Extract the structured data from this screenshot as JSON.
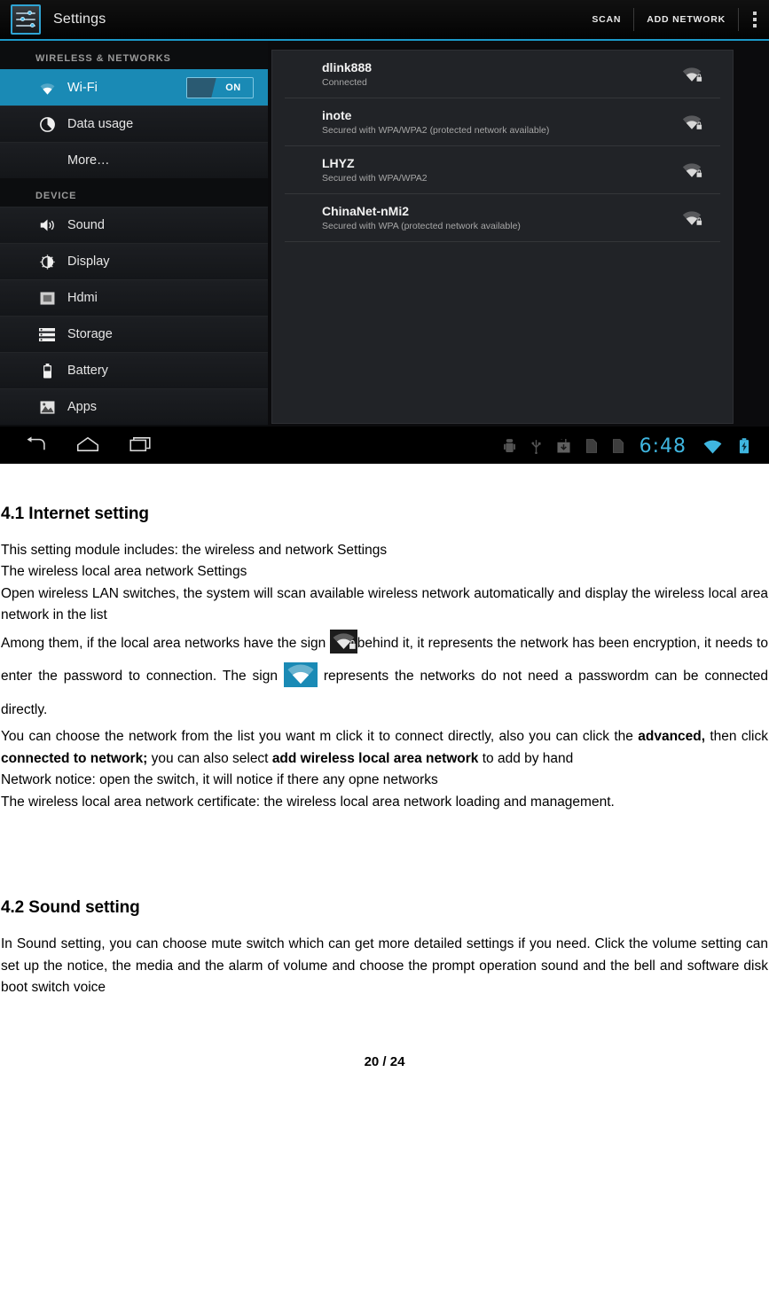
{
  "screenshot": {
    "actionbar": {
      "app_icon": "settings-sliders-icon",
      "title": "Settings",
      "scan_label": "SCAN",
      "add_network_label": "ADD NETWORK",
      "overflow_label": "overflow-menu"
    },
    "sidebar": {
      "sections": [
        {
          "header": "WIRELESS & NETWORKS",
          "items": [
            {
              "label": "Wi-Fi",
              "icon": "wifi-icon",
              "selected": true,
              "toggle": "ON"
            },
            {
              "label": "Data usage",
              "icon": "data-usage-icon",
              "selected": false
            },
            {
              "label": "More…",
              "icon": "",
              "selected": false
            }
          ]
        },
        {
          "header": "DEVICE",
          "items": [
            {
              "label": "Sound",
              "icon": "speaker-icon",
              "selected": false
            },
            {
              "label": "Display",
              "icon": "brightness-icon",
              "selected": false
            },
            {
              "label": "Hdmi",
              "icon": "hdmi-icon",
              "selected": false
            },
            {
              "label": "Storage",
              "icon": "storage-icon",
              "selected": false
            },
            {
              "label": "Battery",
              "icon": "battery-icon",
              "selected": false
            },
            {
              "label": "Apps",
              "icon": "apps-image-icon",
              "selected": false
            }
          ]
        }
      ]
    },
    "networks": [
      {
        "name": "dlink888",
        "status": "Connected",
        "icon": "wifi-lock-icon"
      },
      {
        "name": "inote",
        "status": "Secured with WPA/WPA2 (protected network available)",
        "icon": "wifi-lock-icon"
      },
      {
        "name": "LHYZ",
        "status": "Secured with WPA/WPA2",
        "icon": "wifi-lock-icon"
      },
      {
        "name": "ChinaNet-nMi2",
        "status": "Secured with WPA (protected network available)",
        "icon": "wifi-lock-icon"
      }
    ],
    "navbar": {
      "back": "back-icon",
      "home": "home-icon",
      "recents": "recents-icon",
      "status_icons": [
        "android-debug-icon",
        "usb-icon",
        "download-icon",
        "sd-card-icon",
        "sd-card-icon"
      ],
      "clock": "6:48",
      "wifi": "wifi-status-icon",
      "battery": "battery-charging-icon"
    },
    "colors": {
      "accent_blue": "#1a8ab5",
      "actionbar_underline": "#1b99c9",
      "clock_blue": "#3fb6e0"
    }
  },
  "document": {
    "section1": {
      "heading": "4.1 Internet setting",
      "p1_line1": "This setting module includes: the wireless and network Settings",
      "p1_line2": "The wireless local area network Settings",
      "p1_line3": "Open wireless LAN switches, the system will scan available wireless network automatically and display the wireless local area network in the list",
      "p2_a": "Among them, if the local area networks have the sign ",
      "p2_b": "behind it, it represents the network has been encryption, it needs to enter the password to connection. The sign ",
      "p2_c": " represents the networks do not need a passwordm can be connected directly.",
      "p3_a": "You can choose the network from the list you want m click it to connect directly, also you can click the ",
      "p3_bold1": "advanced,",
      "p3_b": " then click ",
      "p3_bold2": "connected to network;",
      "p3_c": " you can also select ",
      "p3_bold3": "add wireless local area network",
      "p3_d": " to add by hand",
      "p4": "Network notice: open the switch, it will notice if there any opne networks",
      "p5": "The wireless local area network certificate: the wireless local area network loading and management."
    },
    "section2": {
      "heading": "4.2 Sound setting",
      "p1": "In Sound setting, you can choose mute switch which can get more detailed settings if you need. Click the volume setting can set up the notice, the media and the alarm of volume and choose the prompt operation sound and the bell and software disk boot switch voice"
    },
    "page_number": "20 / 24"
  }
}
